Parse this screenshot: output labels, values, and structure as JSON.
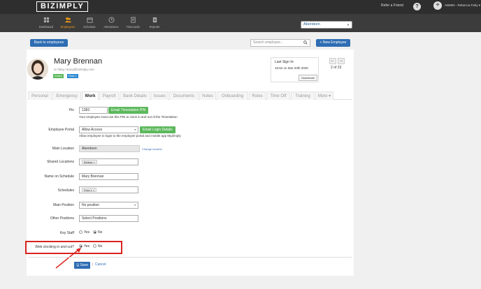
{
  "brand": "BIZIMPLY",
  "topbar": {
    "refer": "Refer a Friend",
    "help_icon": "?",
    "plus_icon": "+",
    "user": "ADMIN - Rebecca Fahy ▾"
  },
  "nav": [
    {
      "label": "Dashboard",
      "icon": "dashboard-icon"
    },
    {
      "label": "Employees",
      "icon": "employees-icon"
    },
    {
      "label": "Schedule",
      "icon": "calendar-icon"
    },
    {
      "label": "Attendance",
      "icon": "clock-icon"
    },
    {
      "label": "Timecards",
      "icon": "timecard-icon"
    },
    {
      "label": "Reports",
      "icon": "report-icon"
    }
  ],
  "nav_active": "Employees",
  "location": "Aberdeen",
  "toolbar": {
    "back": "Back to employees",
    "search_placeholder": "Search employee...",
    "new_employee": "+ New Employee"
  },
  "employee": {
    "name": "Mary Brennan",
    "email": "rfahy+mary@bizimply.com",
    "badge_active": "Active",
    "badge_rota": "Rota 1"
  },
  "signin": {
    "label": "Last Sign In:",
    "value": "15:52 on Mar 20th 2020",
    "deactivate": "Deactivate"
  },
  "pager": {
    "count": "2 of 23",
    "prev": "←",
    "next": "→"
  },
  "tabs": [
    "Personal",
    "Emergency",
    "Work",
    "Payroll",
    "Bank Details",
    "Issues",
    "Documents",
    "Notes",
    "Onboarding",
    "Roles",
    "Time Off",
    "Training",
    "More ▾"
  ],
  "active_tab": "Work",
  "form": {
    "pin_label": "Pin",
    "pin_value": "1383",
    "pin_button": "Email Timestation PIN",
    "pin_help": "Your employee must use this PIN to clock in and out of the Timestation",
    "portal_label": "Employee Portal",
    "portal_value": "Allow Access",
    "portal_button": "Email Login Details",
    "portal_help": "Allow employee to login to the employee portal and mobile app MyZimply",
    "main_location_label": "Main Location",
    "main_location_value": "Aberdeen",
    "change_location": "Change location",
    "shared_locations_label": "Shared Locations",
    "shared_locations_tag": "Belfast ×",
    "name_on_schedule_label": "Name on Schedule",
    "name_on_schedule_value": "Mary  Brennan",
    "schedules_label": "Schedules",
    "schedules_tag": "Rota 1 ×",
    "main_position_label": "Main Position",
    "main_position_value": "No position",
    "other_positions_label": "Other Positions",
    "other_positions_placeholder": "Select Positions",
    "key_staff_label": "Key Staff",
    "key_staff_yes": "Yes",
    "key_staff_no": "No",
    "web_clock_label": "Web clocking in and out?",
    "web_clock_yes": "Yes",
    "web_clock_no": "No"
  },
  "actions": {
    "save": "🖫 Save",
    "separator": "|",
    "cancel": "Cancel"
  },
  "colors": {
    "primary": "#2e6db3",
    "success": "#5cb85c",
    "highlight": "#d9231e",
    "active_nav": "#f39c12"
  }
}
